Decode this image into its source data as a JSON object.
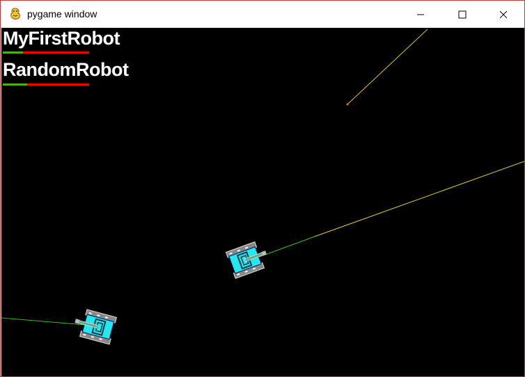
{
  "window": {
    "title": "pygame window",
    "icon": "pygame-snake-icon",
    "controls": [
      "minimize-icon",
      "maximize-icon",
      "close-icon"
    ]
  },
  "robots": [
    {
      "name": "MyFirstRobot",
      "health_fraction": 0.23
    },
    {
      "name": "RandomRobot",
      "health_fraction": 0.28
    }
  ],
  "colors": {
    "arena_background": "#000000",
    "health_good": "#4caf1a",
    "health_bad": "#e00000",
    "tank_body": "#22e8f0",
    "bullet_trail": "#e0d020",
    "radar_line": "#30c020"
  }
}
